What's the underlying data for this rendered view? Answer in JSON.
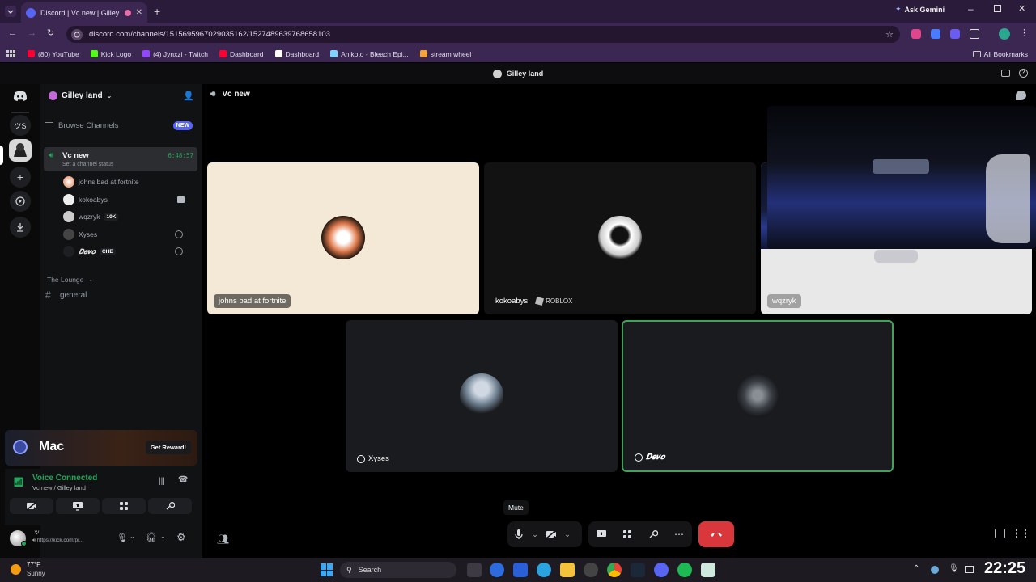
{
  "browser": {
    "tab_title": "Discord | Vc new | Gilley la...",
    "url": "discord.com/channels/1515695967029035162/1527489639768658103",
    "ask_gemini": "Ask Gemini",
    "bookmarks": [
      {
        "label": "(80) YouTube",
        "color": "#ff0033"
      },
      {
        "label": "Kick Logo",
        "color": "#53fc18"
      },
      {
        "label": "(4) Jynxzi - Twitch",
        "color": "#9146ff"
      },
      {
        "label": "Dashboard",
        "color": "#ff0033"
      },
      {
        "label": "Dashboard",
        "color": "#ffffff"
      },
      {
        "label": "Anikoto - Bleach Epi...",
        "color": "#7fd1ff"
      },
      {
        "label": "stream wheel",
        "color": "#f2a33a"
      }
    ],
    "all_bookmarks": "All Bookmarks"
  },
  "discord": {
    "window_title": "Gilley land",
    "server_name": "Gilley land",
    "browse_channels": "Browse Channels",
    "new_badge": "NEW",
    "voice_channel": {
      "name": "Vc new",
      "timer": "6:48:57",
      "status_placeholder": "Set a channel status"
    },
    "users": [
      {
        "name": "johns bad at fortnite",
        "tag": "",
        "badge": ""
      },
      {
        "name": "kokoabys",
        "tag": "",
        "badge": "screen"
      },
      {
        "name": "wqzryk",
        "tag": "10K",
        "badge": ""
      },
      {
        "name": "Xyses",
        "tag": "",
        "badge": "xbox"
      },
      {
        "name": "𝑫𝒆𝒗𝒐",
        "tag": "CHE",
        "badge": "xbox"
      }
    ],
    "category": "The Lounge",
    "text_channel": "general",
    "promo": {
      "brand": "Mac",
      "button": "Get Reward!"
    },
    "voice_connected": "Voice Connected",
    "voice_location": "Vc new / Gilley land",
    "user_status": "https://kick.com/pr...",
    "header_channel": "Vc new",
    "tiles": [
      {
        "label": "johns bad at fortnite",
        "sub": ""
      },
      {
        "label": "kokoabys",
        "sub": "ROBLOX"
      },
      {
        "label": "wqzryk",
        "sub": ""
      },
      {
        "label": "Xyses",
        "sub": ""
      },
      {
        "label": "𝑫𝒆𝒗𝒐",
        "sub": ""
      }
    ],
    "tooltip": "Mute"
  },
  "taskbar": {
    "weather_temp": "77°F",
    "weather_desc": "Sunny",
    "search": "Search",
    "clock": "22:25"
  },
  "colors": {
    "accent": "#5865f2",
    "green": "#23a55a",
    "danger": "#da373c",
    "speaking_border": "#43a25a"
  }
}
